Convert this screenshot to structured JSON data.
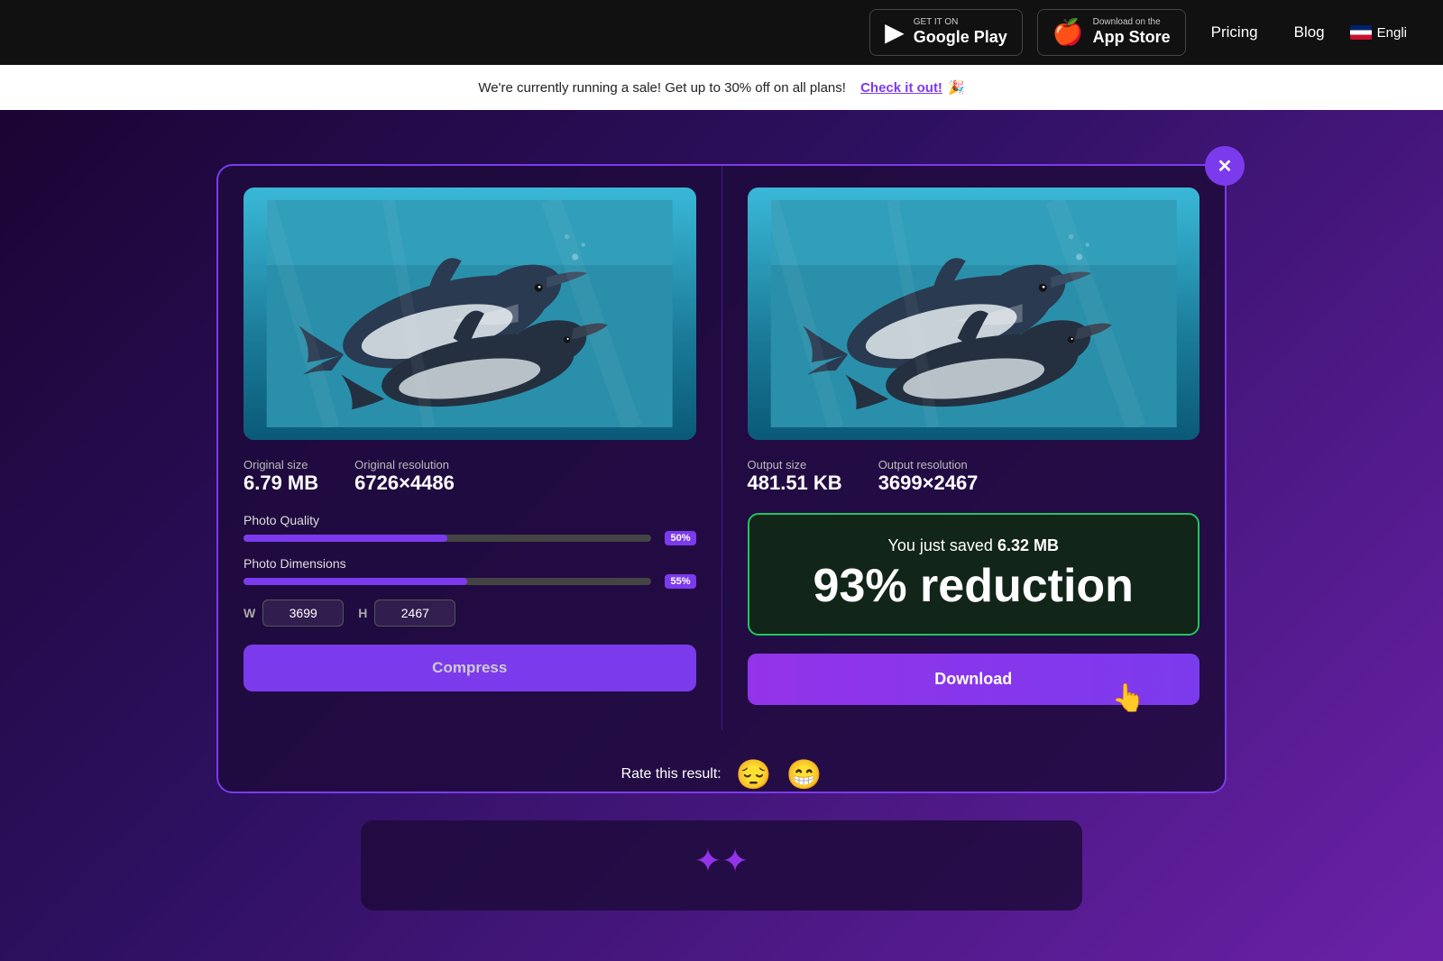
{
  "nav": {
    "google_play_small": "GET IT ON",
    "google_play_big": "Google Play",
    "app_store_small": "Download on the",
    "app_store_big": "App Store",
    "pricing_label": "Pricing",
    "blog_label": "Blog",
    "lang_label": "Engli"
  },
  "banner": {
    "text": "We're currently running a sale! Get up to 30% off on all plans!",
    "link_text": "Check it out!",
    "emoji": "🎉"
  },
  "left_panel": {
    "original_size_label": "Original size",
    "original_size_value": "6.79 MB",
    "original_resolution_label": "Original resolution",
    "original_resolution_value": "6726×4486",
    "quality_label": "Photo Quality",
    "quality_percent": "50%",
    "dimensions_label": "Photo Dimensions",
    "dimensions_percent": "55%",
    "width_label": "W",
    "width_value": "3699",
    "height_label": "H",
    "height_value": "2467",
    "compress_btn_label": "Compress"
  },
  "right_panel": {
    "output_size_label": "Output size",
    "output_size_value": "481.51 KB",
    "output_resolution_label": "Output resolution",
    "output_resolution_value": "3699×2467",
    "savings_text": "You just saved",
    "savings_amount": "6.32 MB",
    "savings_percent": "93% reduction",
    "download_btn_label": "Download"
  },
  "rate": {
    "label": "Rate this result:",
    "emoji_sad": "😔",
    "emoji_happy": "😁"
  },
  "colors": {
    "accent": "#7c3aed",
    "green": "#22c55e",
    "bg": "#1a0533"
  }
}
